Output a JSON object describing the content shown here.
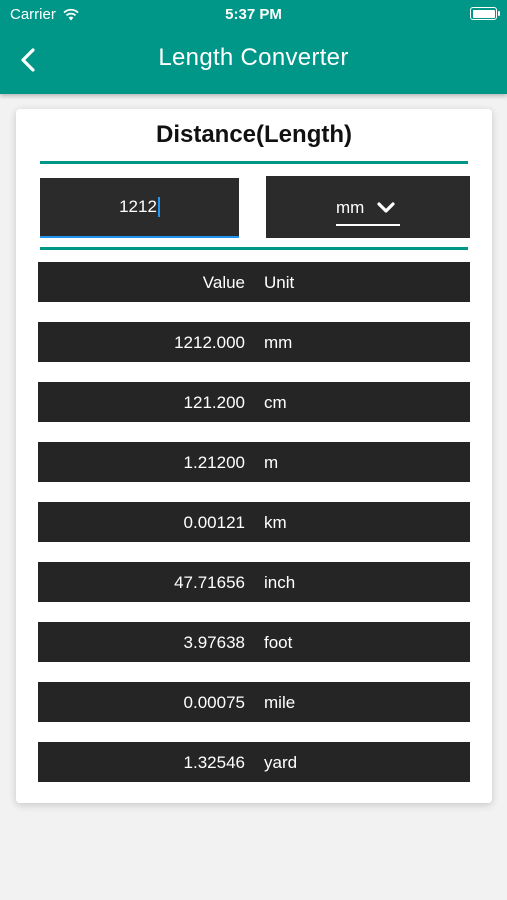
{
  "status_bar": {
    "carrier": "Carrier",
    "time": "5:37 PM"
  },
  "app_bar": {
    "title": "Length Converter"
  },
  "card": {
    "title": "Distance(Length)",
    "input_value": "1212",
    "selected_unit": "mm"
  },
  "table": {
    "header": {
      "value": "Value",
      "unit": "Unit"
    },
    "rows": [
      {
        "value": "1212.000",
        "unit": "mm"
      },
      {
        "value": "121.200",
        "unit": "cm"
      },
      {
        "value": "1.21200",
        "unit": "m"
      },
      {
        "value": "0.00121",
        "unit": "km"
      },
      {
        "value": "47.71656",
        "unit": "inch"
      },
      {
        "value": "3.97638",
        "unit": "foot"
      },
      {
        "value": "0.00075",
        "unit": "mile"
      },
      {
        "value": "1.32546",
        "unit": "yard"
      }
    ]
  },
  "colors": {
    "primary": "#009688",
    "row_bg": "#252525",
    "input_bg": "#2b2b2b",
    "cursor": "#2196f3"
  },
  "icons": {
    "back": "chevron-left-icon",
    "dropdown": "chevron-down-icon",
    "wifi": "wifi-icon",
    "battery": "battery-icon"
  }
}
